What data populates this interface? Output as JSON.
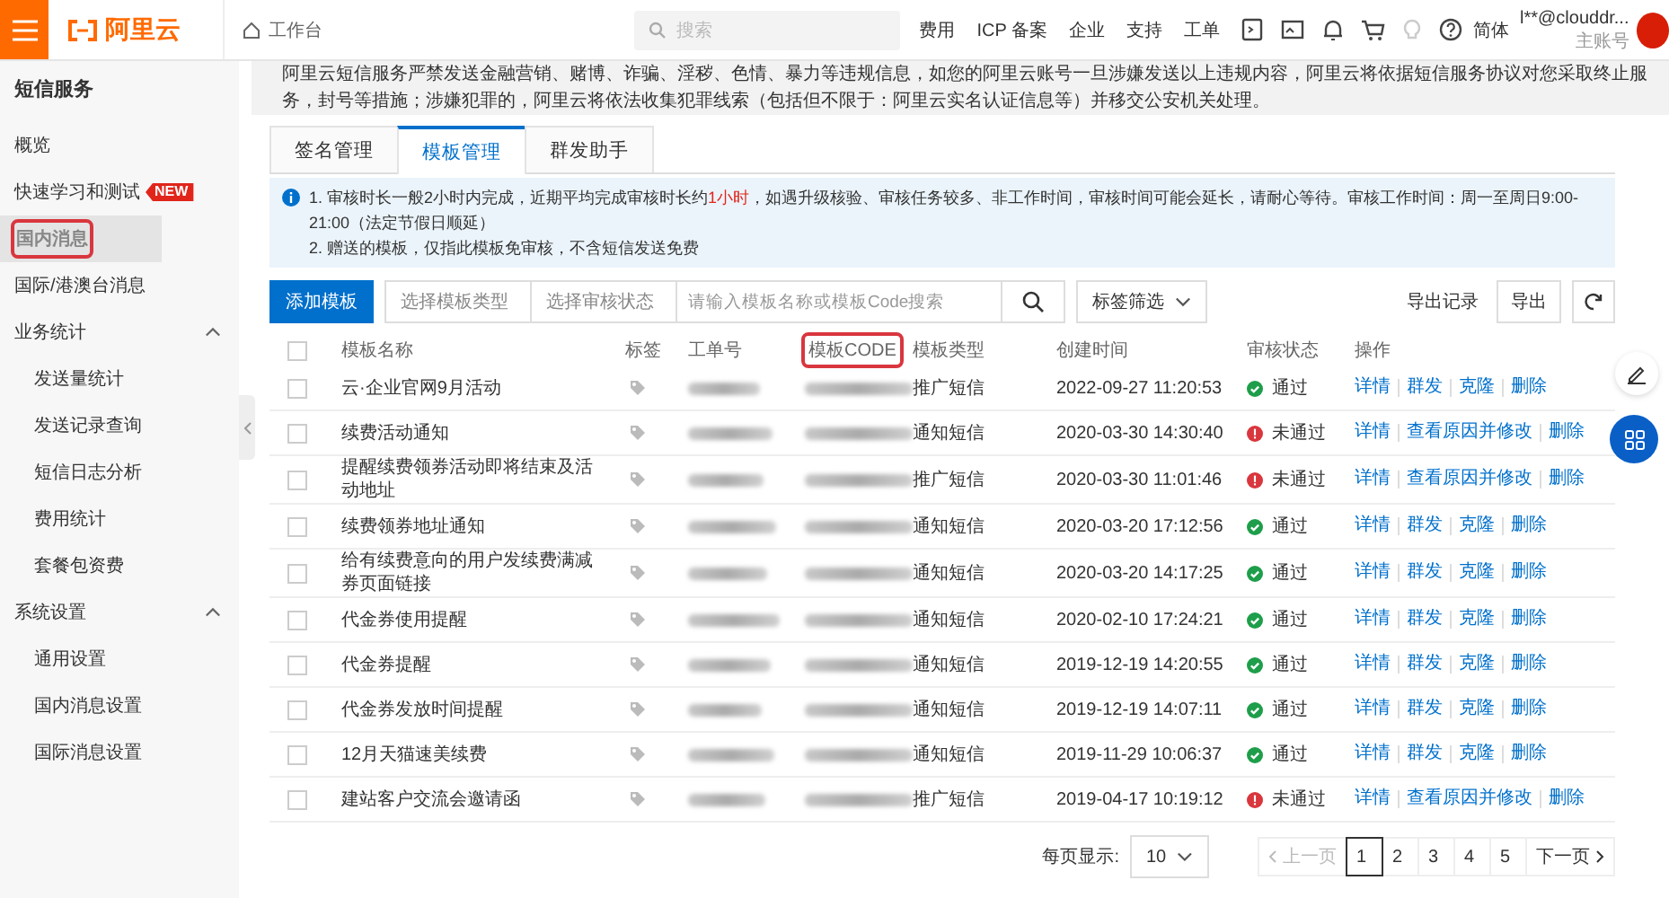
{
  "header": {
    "logo": "阿里云",
    "workbench": "工作台",
    "search_placeholder": "搜索",
    "nav": [
      "费用",
      "ICP 备案",
      "企业",
      "支持",
      "工单"
    ],
    "language": "简体",
    "account": "l**@clouddr...",
    "account_role": "主账号"
  },
  "notice": "阿里云短信服务严禁发送金融营销、赌博、诈骗、淫秽、色情、暴力等违规信息，如您的阿里云账号一旦涉嫌发送以上违规内容，阿里云将依据短信服务协议对您采取终止服务，封号等措施；涉嫌犯罪的，阿里云将依法收集犯罪线索（包括但不限于：阿里云实名认证信息等）并移交公安机关处理。",
  "sidebar": {
    "title": "短信服务",
    "items": [
      {
        "kind": "item",
        "label": "概览",
        "selected": false,
        "highlighted": false
      },
      {
        "kind": "item",
        "label": "快速学习和测试",
        "badge": "NEW",
        "selected": false,
        "highlighted": false
      },
      {
        "kind": "item",
        "label": "国内消息",
        "selected": true,
        "highlighted": true
      },
      {
        "kind": "item",
        "label": "国际/港澳台消息",
        "selected": false,
        "highlighted": false
      },
      {
        "kind": "group",
        "label": "业务统计",
        "expanded": true
      },
      {
        "kind": "sub",
        "label": "发送量统计",
        "selected": false,
        "highlighted": false
      },
      {
        "kind": "sub",
        "label": "发送记录查询",
        "selected": false,
        "highlighted": false
      },
      {
        "kind": "sub",
        "label": "短信日志分析",
        "selected": false,
        "highlighted": false
      },
      {
        "kind": "sub",
        "label": "费用统计",
        "selected": false,
        "highlighted": false
      },
      {
        "kind": "sub",
        "label": "套餐包资费",
        "selected": false,
        "highlighted": false
      },
      {
        "kind": "group",
        "label": "系统设置",
        "expanded": true
      },
      {
        "kind": "sub",
        "label": "通用设置",
        "selected": false,
        "highlighted": false
      },
      {
        "kind": "sub",
        "label": "国内消息设置",
        "selected": false,
        "highlighted": false
      },
      {
        "kind": "sub",
        "label": "国际消息设置",
        "selected": false,
        "highlighted": false
      }
    ]
  },
  "tabs": [
    {
      "label": "签名管理",
      "selected": false
    },
    {
      "label": "模板管理",
      "selected": true
    },
    {
      "label": "群发助手",
      "selected": false
    }
  ],
  "info": [
    {
      "before": "1. 审核时长一般2小时内完成，近期平均完成审核时长约",
      "highlight": "1小时",
      "after": "，如遇升级核验、审核任务较多、非工作时间，审核时间可能会延长，请耐心等待。审核工作时间：周一至周日9:00-21:00（法定节假日顺延）"
    },
    {
      "before": "2. 赠送的模板，仅指此模板免审核，不含短信发送免费"
    }
  ],
  "toolbar": {
    "add": "添加模板",
    "type_select": "选择模板类型",
    "status_select": "选择审核状态",
    "search_placeholder": "请输入模板名称或模板Code搜索",
    "tag_filter": "标签筛选",
    "export_records": "导出记录",
    "export": "导出"
  },
  "table": {
    "all_checked": false,
    "columns": [
      {
        "label": "模板名称",
        "highlighted": false
      },
      {
        "label": "标签",
        "highlighted": false
      },
      {
        "label": "工单号",
        "highlighted": false
      },
      {
        "label": "模板CODE",
        "highlighted": true
      },
      {
        "label": "模板类型",
        "highlighted": false
      },
      {
        "label": "创建时间",
        "highlighted": false
      },
      {
        "label": "审核状态",
        "highlighted": false
      },
      {
        "label": "操作",
        "highlighted": false
      }
    ],
    "rows": [
      {
        "checked": false,
        "name": "云·企业官网9月活动",
        "type": "推广短信",
        "created": "2022-09-27 11:20:53",
        "kind": "pass",
        "status_label": "通过",
        "actions": [
          "详情",
          "群发",
          "克隆",
          "删除"
        ]
      },
      {
        "checked": false,
        "name": "续费活动通知",
        "type": "通知短信",
        "created": "2020-03-30 14:30:40",
        "kind": "fail",
        "status_label": "未通过",
        "actions": [
          "详情",
          "查看原因并修改",
          "删除"
        ]
      },
      {
        "checked": false,
        "name": "提醒续费领券活动即将结束及活动地址",
        "type": "推广短信",
        "created": "2020-03-30 11:01:46",
        "kind": "fail",
        "status_label": "未通过",
        "actions": [
          "详情",
          "查看原因并修改",
          "删除"
        ]
      },
      {
        "checked": false,
        "name": "续费领券地址通知",
        "type": "通知短信",
        "created": "2020-03-20 17:12:56",
        "kind": "pass",
        "status_label": "通过",
        "actions": [
          "详情",
          "群发",
          "克隆",
          "删除"
        ]
      },
      {
        "checked": false,
        "name": "给有续费意向的用户发续费满减券页面链接",
        "type": "通知短信",
        "created": "2020-03-20 14:17:25",
        "kind": "pass",
        "status_label": "通过",
        "actions": [
          "详情",
          "群发",
          "克隆",
          "删除"
        ]
      },
      {
        "checked": false,
        "name": "代金券使用提醒",
        "type": "通知短信",
        "created": "2020-02-10 17:24:21",
        "kind": "pass",
        "status_label": "通过",
        "actions": [
          "详情",
          "群发",
          "克隆",
          "删除"
        ]
      },
      {
        "checked": false,
        "name": "代金券提醒",
        "type": "通知短信",
        "created": "2019-12-19 14:20:55",
        "kind": "pass",
        "status_label": "通过",
        "actions": [
          "详情",
          "群发",
          "克隆",
          "删除"
        ]
      },
      {
        "checked": false,
        "name": "代金券发放时间提醒",
        "type": "通知短信",
        "created": "2019-12-19 14:07:11",
        "kind": "pass",
        "status_label": "通过",
        "actions": [
          "详情",
          "群发",
          "克隆",
          "删除"
        ]
      },
      {
        "checked": false,
        "name": "12月天猫速美续费",
        "type": "通知短信",
        "created": "2019-11-29 10:06:37",
        "kind": "pass",
        "status_label": "通过",
        "actions": [
          "详情",
          "群发",
          "克隆",
          "删除"
        ]
      },
      {
        "checked": false,
        "name": "建站客户交流会邀请函",
        "type": "推广短信",
        "created": "2019-04-17 10:19:12",
        "kind": "fail",
        "status_label": "未通过",
        "actions": [
          "详情",
          "查看原因并修改",
          "删除"
        ]
      }
    ]
  },
  "pagination": {
    "page_size_label": "每页显示:",
    "page_size": "10",
    "prev": "上一页",
    "pages": [
      {
        "label": "1",
        "selected": true
      },
      {
        "label": "2",
        "selected": false
      },
      {
        "label": "3",
        "selected": false
      },
      {
        "label": "4",
        "selected": false
      },
      {
        "label": "5",
        "selected": false
      }
    ],
    "next": "下一页"
  }
}
